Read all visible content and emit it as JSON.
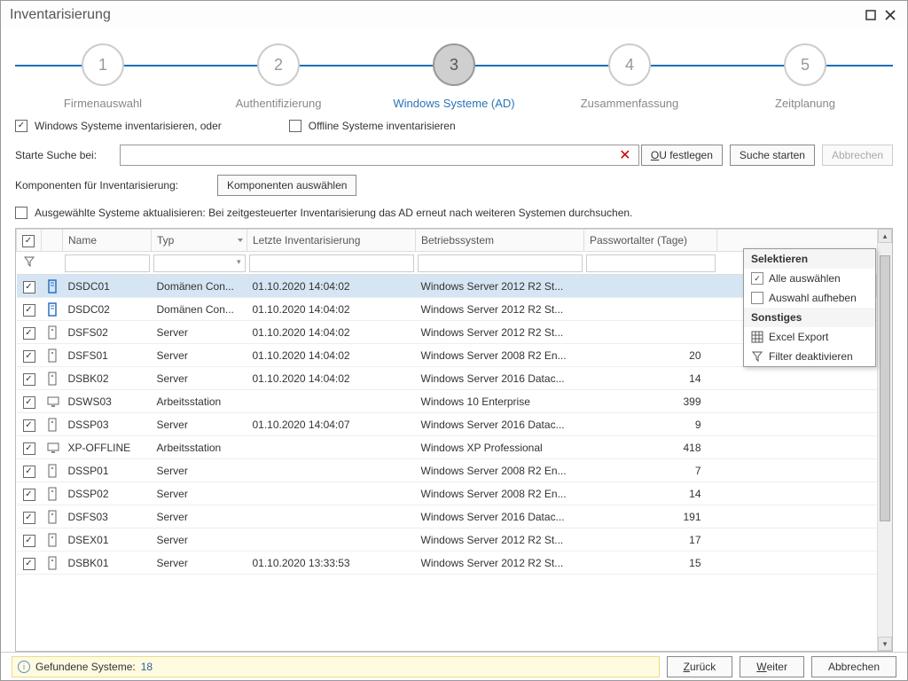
{
  "window": {
    "title": "Inventarisierung"
  },
  "stepper": {
    "steps": [
      {
        "num": "1",
        "label": "Firmenauswahl"
      },
      {
        "num": "2",
        "label": "Authentifizierung"
      },
      {
        "num": "3",
        "label": "Windows Systeme (AD)"
      },
      {
        "num": "4",
        "label": "Zusammenfassung"
      },
      {
        "num": "5",
        "label": "Zeitplanung"
      }
    ],
    "active_index": 2
  },
  "options": {
    "inventory_windows": "Windows Systeme inventarisieren, oder",
    "inventory_offline": "Offline Systeme inventarisieren",
    "search_label": "Starte Suche bei:",
    "ou_button": "OU festlegen",
    "search_button": "Suche starten",
    "cancel_button": "Abbrechen",
    "components_label": "Komponenten für Inventarisierung:",
    "components_button": "Komponenten auswählen",
    "update_selected": "Ausgewählte Systeme aktualisieren: Bei zeitgesteuerter Inventarisierung das AD erneut nach weiteren Systemen durchsuchen."
  },
  "grid": {
    "headers": {
      "name": "Name",
      "typ": "Typ",
      "last": "Letzte Inventarisierung",
      "os": "Betriebssystem",
      "age": "Passwortalter (Tage)"
    },
    "rows": [
      {
        "name": "DSDC01",
        "typ": "Domänen Con...",
        "last": "01.10.2020 14:04:02",
        "os": "Windows Server 2012 R2 St...",
        "age": "",
        "icon": "dc",
        "sel": true
      },
      {
        "name": "DSDC02",
        "typ": "Domänen Con...",
        "last": "01.10.2020 14:04:02",
        "os": "Windows Server 2012 R2 St...",
        "age": "",
        "icon": "dc"
      },
      {
        "name": "DSFS02",
        "typ": "Server",
        "last": "01.10.2020 14:04:02",
        "os": "Windows Server 2012 R2 St...",
        "age": "",
        "icon": "srv"
      },
      {
        "name": "DSFS01",
        "typ": "Server",
        "last": "01.10.2020 14:04:02",
        "os": "Windows Server 2008 R2 En...",
        "age": "20",
        "icon": "srv"
      },
      {
        "name": "DSBK02",
        "typ": "Server",
        "last": "01.10.2020 14:04:02",
        "os": "Windows Server 2016 Datac...",
        "age": "14",
        "icon": "srv"
      },
      {
        "name": "DSWS03",
        "typ": "Arbeitsstation",
        "last": "",
        "os": "Windows 10 Enterprise",
        "age": "399",
        "icon": "ws"
      },
      {
        "name": "DSSP03",
        "typ": "Server",
        "last": "01.10.2020 14:04:07",
        "os": "Windows Server 2016 Datac...",
        "age": "9",
        "icon": "srv"
      },
      {
        "name": "XP-OFFLINE",
        "typ": "Arbeitsstation",
        "last": "",
        "os": "Windows XP Professional",
        "age": "418",
        "icon": "ws"
      },
      {
        "name": "DSSP01",
        "typ": "Server",
        "last": "",
        "os": "Windows Server 2008 R2 En...",
        "age": "7",
        "icon": "srv"
      },
      {
        "name": "DSSP02",
        "typ": "Server",
        "last": "",
        "os": "Windows Server 2008 R2 En...",
        "age": "14",
        "icon": "srv"
      },
      {
        "name": "DSFS03",
        "typ": "Server",
        "last": "",
        "os": "Windows Server 2016 Datac...",
        "age": "191",
        "icon": "srv"
      },
      {
        "name": "DSEX01",
        "typ": "Server",
        "last": "",
        "os": "Windows Server 2012 R2 St...",
        "age": "17",
        "icon": "srv"
      },
      {
        "name": "DSBK01",
        "typ": "Server",
        "last": "01.10.2020 13:33:53",
        "os": "Windows Server 2012 R2 St...",
        "age": "15",
        "icon": "srv"
      }
    ]
  },
  "context_menu": {
    "section1": "Selektieren",
    "select_all": "Alle auswählen",
    "deselect": "Auswahl aufheben",
    "section2": "Sonstiges",
    "excel": "Excel Export",
    "filter_off": "Filter deaktivieren"
  },
  "footer": {
    "status_label": "Gefundene Systeme:",
    "status_count": "18",
    "back": "Zurück",
    "next": "Weiter",
    "cancel": "Abbrechen"
  }
}
